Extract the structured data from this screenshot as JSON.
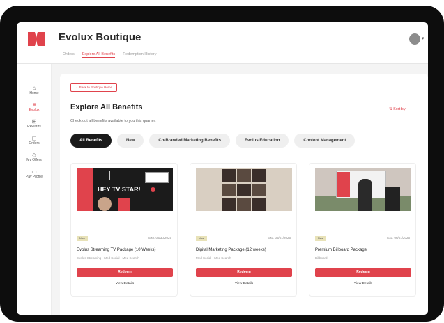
{
  "header": {
    "title": "Evolux Boutique",
    "subtabs": [
      "Orders",
      "Explore All Benefits",
      "Redemption History"
    ]
  },
  "sidebar": {
    "items": [
      {
        "label": "Home",
        "icon": "home-icon",
        "glyph": "⌂",
        "active": false
      },
      {
        "label": "Evolux",
        "icon": "list-icon",
        "glyph": "≡",
        "active": true
      },
      {
        "label": "Rewards",
        "icon": "gift-icon",
        "glyph": "⊞",
        "active": false
      },
      {
        "label": "Orders",
        "icon": "bag-icon",
        "glyph": "◻",
        "active": false
      },
      {
        "label": "My Offers",
        "icon": "tag-icon",
        "glyph": "◇",
        "active": false
      },
      {
        "label": "Pay Profile",
        "icon": "card-icon",
        "glyph": "▭",
        "active": false
      }
    ]
  },
  "main": {
    "back_button": "← Back to Boutique Home",
    "title": "Explore All Benefits",
    "subtitle": "Check out all benefits available to you this quarter.",
    "sort_label": "Sort by",
    "filters": [
      "All Benefits",
      "New",
      "Co-Branded Marketing Benefits",
      "Evolus Education",
      "Content Management"
    ],
    "active_filter": "All Benefits"
  },
  "cards": [
    {
      "badge": "New",
      "date": "Exp. 06/30/2025",
      "title": "Evolus Streaming TV Package (10 Weeks)",
      "tags": "Evolus Streaming · Med Social · Med Search",
      "redeem": "Redeem",
      "details": "View Details",
      "image_text": "HEY TV STAR!"
    },
    {
      "badge": "New",
      "date": "Exp. 06/01/2025",
      "title": "Digital Marketing Package (12 weeks)",
      "tags": "Med Social · Med Search",
      "redeem": "Redeem",
      "details": "View Details"
    },
    {
      "badge": "New",
      "date": "Exp. 06/01/2025",
      "title": "Premium Billboard Package",
      "tags": "Billboard",
      "redeem": "Redeem",
      "details": "View Details"
    }
  ],
  "colors": {
    "accent": "#e0434c",
    "dark": "#1a1a1a",
    "badge": "#e8e2b8"
  }
}
